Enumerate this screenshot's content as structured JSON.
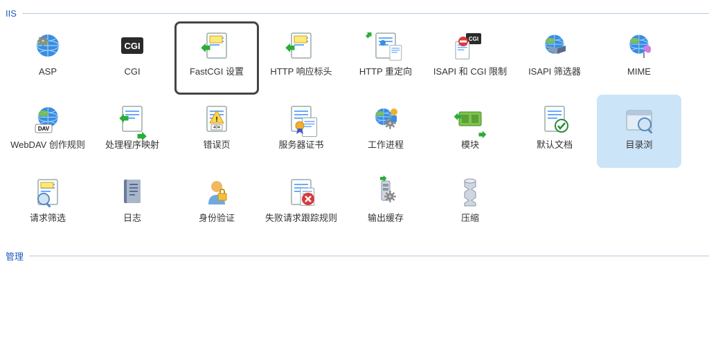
{
  "groups": [
    {
      "title": "IIS",
      "items": [
        {
          "key": "asp",
          "label": "ASP",
          "icon": "asp"
        },
        {
          "key": "cgi",
          "label": "CGI",
          "icon": "cgi"
        },
        {
          "key": "fastcgi",
          "label": "FastCGI 设置",
          "icon": "fastcgi",
          "highlighted": true
        },
        {
          "key": "http-response",
          "label": "HTTP 响应标头",
          "icon": "httpresp"
        },
        {
          "key": "http-redirect",
          "label": "HTTP 重定向",
          "icon": "redirect"
        },
        {
          "key": "isapi-cgi-restrict",
          "label": "ISAPI 和 CGI 限制",
          "icon": "isapicgi"
        },
        {
          "key": "isapi-filters",
          "label": "ISAPI 筛选器",
          "icon": "filters"
        },
        {
          "key": "mime",
          "label": "MIME",
          "icon": "mime"
        },
        {
          "key": "webdav",
          "label": "WebDAV 创作规则",
          "icon": "webdav"
        },
        {
          "key": "handler-mapping",
          "label": "处理程序映射",
          "icon": "handler"
        },
        {
          "key": "error-pages",
          "label": "错误页",
          "icon": "error"
        },
        {
          "key": "server-cert",
          "label": "服务器证书",
          "icon": "cert"
        },
        {
          "key": "worker-process",
          "label": "工作进程",
          "icon": "worker"
        },
        {
          "key": "modules",
          "label": "模块",
          "icon": "modules"
        },
        {
          "key": "default-doc",
          "label": "默认文档",
          "icon": "defdoc"
        },
        {
          "key": "dir-browse",
          "label": "目录浏",
          "icon": "dirbrowse",
          "hovered": true
        },
        {
          "key": "request-filter",
          "label": "请求筛选",
          "icon": "reqfilter"
        },
        {
          "key": "logging",
          "label": "日志",
          "icon": "log"
        },
        {
          "key": "auth",
          "label": "身份验证",
          "icon": "auth"
        },
        {
          "key": "failed-request",
          "label": "失败请求跟踪规则",
          "icon": "failed"
        },
        {
          "key": "output-cache",
          "label": "输出缓存",
          "icon": "cache"
        },
        {
          "key": "compression",
          "label": "压缩",
          "icon": "compress"
        }
      ]
    },
    {
      "title": "管理",
      "items": []
    }
  ]
}
